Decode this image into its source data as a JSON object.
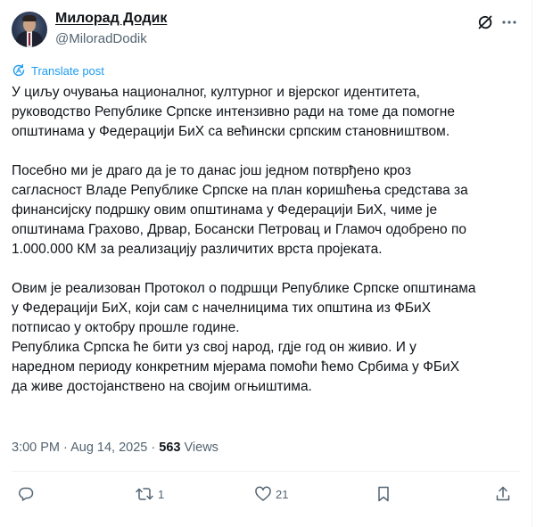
{
  "author": {
    "name": "Милорад Додик",
    "handle": "@MiloradDodik"
  },
  "translate_label": "Translate post",
  "paragraphs": [
    [
      "У циљу очувања националног, културног и вјерског идентитета,",
      "руководство Републике Српске интензивно ради на томе да помогне",
      "општинама у Федерацији БиХ са већински српским становништвом."
    ],
    [
      "Посебно ми је драго да је то данас још једном потврђено кроз",
      "сагласност Владе Републике Српске на план коришћења средстава за",
      "финансијску подршку овим општинама у Федерацији БиХ, чиме је",
      "општинама Грахово, Дрвар, Босански Петровац и Гламоч одобрено по",
      "1.000.000 КМ за реализацију различитих врста пројеката."
    ],
    [
      "Овим је реализован Протокол о подршци Републике Српске општинама",
      "у Федерацији БиХ, који сам с начелницима тих општина из ФБиХ",
      "потписао у октобру прошле године.",
      "Република Српска ће бити уз свој народ, гдје год он живио. И у",
      "наредном периоду конкретним мјерама помоћи ћемо Србима у ФБиХ",
      "да живе достојанствено на својим огњиштима."
    ]
  ],
  "meta": {
    "time": "3:00 PM",
    "separator": " · ",
    "date": "Aug 14, 2025",
    "views_count": "563",
    "views_label": "Views"
  },
  "actions": {
    "replies": "",
    "reposts": "1",
    "likes": "21"
  },
  "colors": {
    "text": "#0f1419",
    "secondary": "#536471",
    "link": "#1d9bf0",
    "divider": "#eff3f4"
  },
  "icons": [
    "grok-icon",
    "more-icon",
    "translate-icon",
    "reply-icon",
    "repost-icon",
    "like-icon",
    "bookmark-icon",
    "share-icon"
  ]
}
